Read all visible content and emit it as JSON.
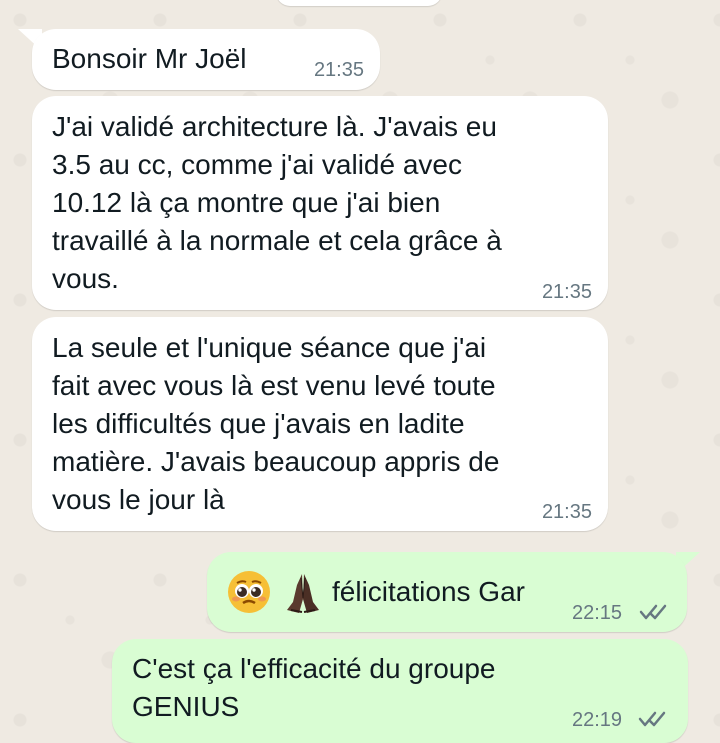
{
  "messages": [
    {
      "direction": "incoming",
      "text": "Bonsoir Mr Joël",
      "time": "21:35"
    },
    {
      "direction": "incoming",
      "text": "J'ai validé architecture là. J'avais eu\n3.5 au cc, comme j'ai validé avec\n10.12 là ça montre que j'ai bien\ntravaillé à la normale et cela grâce à\nvous.",
      "time": "21:35"
    },
    {
      "direction": "incoming",
      "text": "La seule et l'unique séance que j'ai\nfait avec vous là est venu levé toute\nles difficultés que j'avais en ladite\nmatière. J'avais beaucoup appris de\nvous le jour là",
      "time": "21:35"
    },
    {
      "direction": "outgoing",
      "emojis": [
        "pleading-face-icon",
        "folded-hands-icon"
      ],
      "text": "félicitations Gar",
      "time": "22:15",
      "status": "read"
    },
    {
      "direction": "outgoing",
      "text": "C'est ça l'efficacité du groupe\nGENIUS",
      "time": "22:19",
      "status": "read"
    }
  ],
  "colors": {
    "background": "#efeae2",
    "incoming_bubble": "#ffffff",
    "outgoing_bubble": "#d9fdd3",
    "text": "#111b21",
    "timestamp": "#667781",
    "ticks": "#667781"
  }
}
